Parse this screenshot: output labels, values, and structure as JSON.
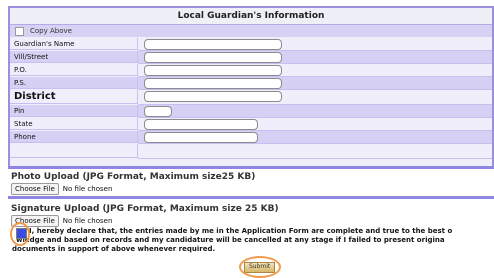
{
  "guardian": {
    "title": "Local Guardian's Information",
    "copy_label": "Copy Above",
    "fields": [
      {
        "label": "Guardian's Name"
      },
      {
        "label": "Vill/Street"
      },
      {
        "label": "P.O."
      },
      {
        "label": "P.S."
      },
      {
        "label": "District"
      },
      {
        "label": "Pin"
      },
      {
        "label": "State"
      },
      {
        "label": "Phone"
      }
    ]
  },
  "photo": {
    "title": "Photo Upload (JPG Format, Maximum size25 KB)",
    "choose_label": "Choose File",
    "status": "No file chosen"
  },
  "signature": {
    "title": "Signature Upload (JPG Format, Maximum size 25 KB)",
    "choose_label": "Choose File",
    "status": "No file chosen"
  },
  "declaration": {
    "line1": "I, hereby declare that, the entries made by me in the Application Form are complete and true to the best o",
    "line2": "wledge and based on records and my candidature will be cancelled at any stage if I failed to present origina",
    "line3": "documents in support of above whenever required."
  },
  "submit_label": "Submit",
  "colors": {
    "accent": "#8f86e3",
    "row_shade": "#d5d0f4",
    "highlight_ring": "#f29a4a"
  }
}
